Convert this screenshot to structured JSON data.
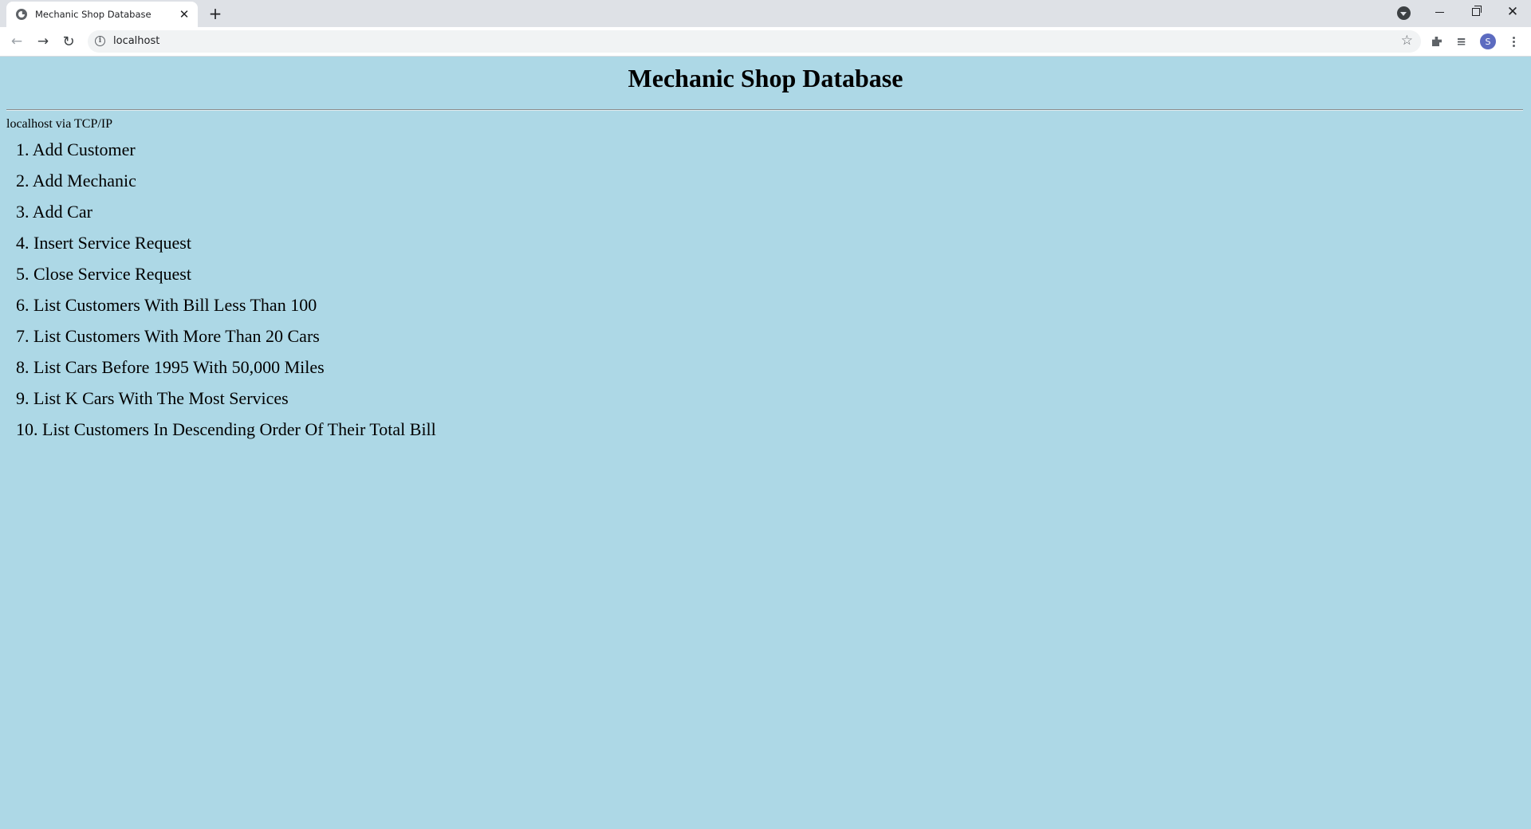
{
  "browser": {
    "tab_title": "Mechanic Shop Database",
    "tab_close": "✕",
    "new_tab": "+",
    "url": "localhost",
    "avatar_letter": "S",
    "icons": {
      "favicon": "globe-icon",
      "back": "arrow-left-icon",
      "forward": "arrow-right-icon",
      "reload": "reload-icon",
      "info": "info-icon",
      "bookmark": "star-icon",
      "extensions": "puzzle-icon",
      "media": "media-queue-icon",
      "menu": "kebab-menu-icon"
    }
  },
  "page": {
    "background_color": "#add8e6",
    "title": "Mechanic Shop Database",
    "connection": "localhost via TCP/IP",
    "menu": [
      {
        "label": "1. Add Customer"
      },
      {
        "label": "2. Add Mechanic"
      },
      {
        "label": "3. Add Car"
      },
      {
        "label": "4. Insert Service Request"
      },
      {
        "label": "5. Close Service Request"
      },
      {
        "label": "6. List Customers With Bill Less Than 100"
      },
      {
        "label": "7. List Customers With More Than 20 Cars"
      },
      {
        "label": "8. List Cars Before 1995 With 50,000 Miles"
      },
      {
        "label": "9. List K Cars With The Most Services"
      },
      {
        "label": "10. List Customers In Descending Order Of Their Total Bill"
      }
    ]
  }
}
